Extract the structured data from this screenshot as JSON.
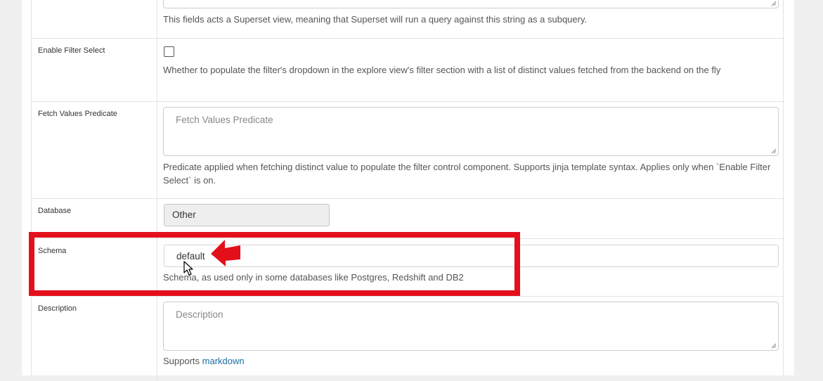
{
  "form": {
    "sql_help": "This fields acts a Superset view, meaning that Superset will run a query against this string as a subquery.",
    "filter_select": {
      "label": "Enable Filter Select",
      "checked": false,
      "help": "Whether to populate the filter's dropdown in the explore view's filter section with a list of distinct values fetched from the backend on the fly"
    },
    "fetch_values": {
      "label": "Fetch Values Predicate",
      "placeholder": "Fetch Values Predicate",
      "help": "Predicate applied when fetching distinct value to populate the filter control component. Supports jinja template syntax. Applies only when `Enable Filter Select` is on."
    },
    "database": {
      "label": "Database",
      "value": "Other"
    },
    "schema": {
      "label": "Schema",
      "value": "default",
      "help": "Schema, as used only in some databases like Postgres, Redshift and DB2"
    },
    "description": {
      "label": "Description",
      "placeholder": "Description",
      "help_prefix": "Supports",
      "help_link": "markdown"
    }
  },
  "annotation": {
    "highlight_color": "#e3101b"
  },
  "icons": [
    "resize-grip-icon",
    "red-arrow-icon",
    "mouse-cursor-icon"
  ]
}
